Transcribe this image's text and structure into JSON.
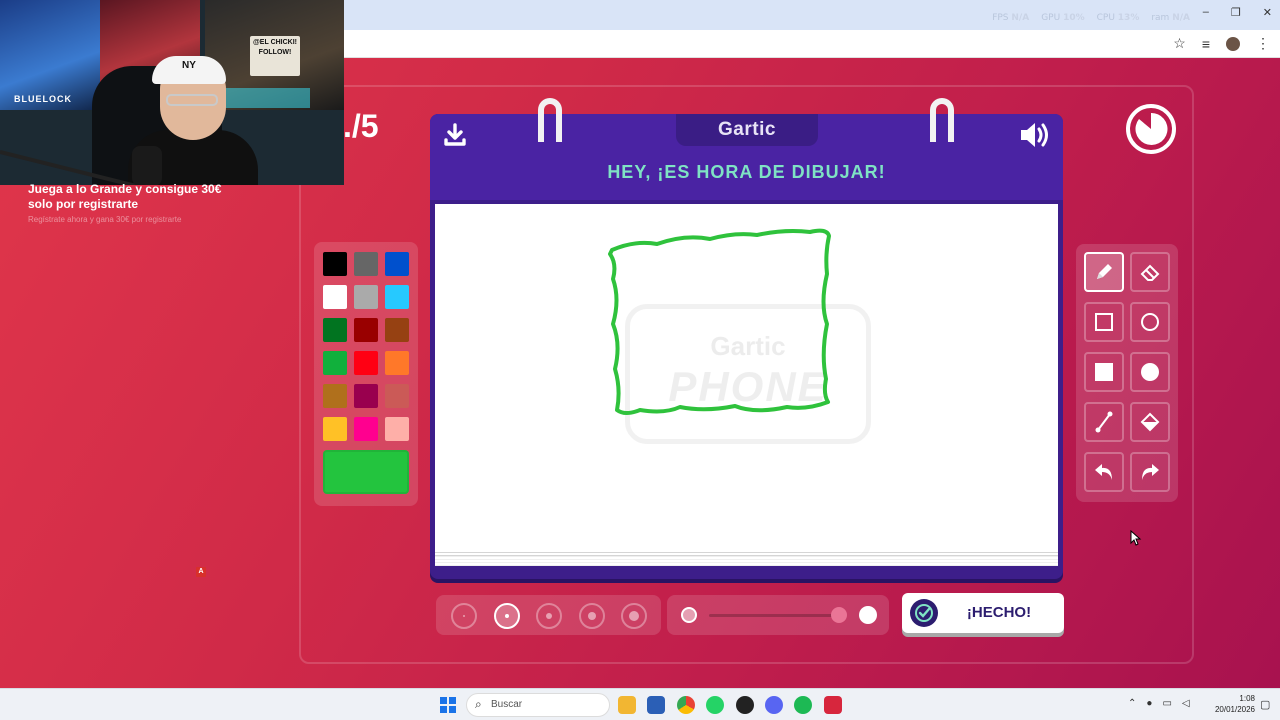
{
  "hud": {
    "fps_label": "FPS",
    "fps_value": "N/A",
    "gpu_label": "GPU",
    "gpu_value": "10%",
    "cpu_label": "CPU",
    "cpu_value": "13%",
    "ram_label": "ram",
    "ram_value": "N/A"
  },
  "window_controls": {
    "minimize": "–",
    "restore": "❐",
    "close": "✕"
  },
  "browser": {
    "star_icon": "☆",
    "queue_icon": "≡",
    "menu_icon": "⋮"
  },
  "stream": {
    "sign_text": "@EL CHICKI! FOLLOW!",
    "poster_text": "BLUELOCK",
    "cap_logo": "NY",
    "promo_title": "Juega a lo Grande y consigue 30€ solo por registrarte",
    "promo_sub": "Regístrate ahora y gana 30€ por registrarte",
    "overlay_marker": "A"
  },
  "game": {
    "round_text": "./5",
    "logo": "Gartic",
    "title": "HEY, ¡ES HORA DE DIBUJAR!",
    "watermark_top": "Gartic",
    "watermark_bottom": "PHONE",
    "done_label": "¡HECHO!",
    "colors": [
      "#000000",
      "#666666",
      "#0050cd",
      "#ffffff",
      "#aaaaaa",
      "#26c9ff",
      "#017420",
      "#990000",
      "#964112",
      "#11b03c",
      "#ff0013",
      "#ff7829",
      "#b0701c",
      "#99004e",
      "#cb5a57",
      "#ffc126",
      "#ff008f",
      "#feafa8"
    ],
    "current_color": "#23c43e",
    "stroke_color": "#2fc23c",
    "tools": [
      "pencil",
      "eraser",
      "rectangle-outline",
      "ellipse-outline",
      "rectangle-filled",
      "ellipse-filled",
      "line",
      "fill-bucket",
      "undo",
      "redo"
    ],
    "active_tool": "pencil",
    "brush_sizes": 5,
    "active_brush_size": 2,
    "opacity_percent": 100
  },
  "taskbar": {
    "search_placeholder": "Buscar",
    "time": "1:08",
    "date": "20/01/2026"
  }
}
